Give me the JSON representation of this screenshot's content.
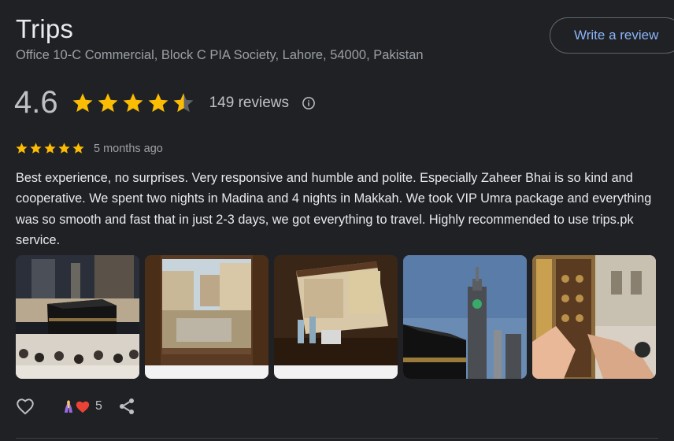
{
  "business": {
    "name": "Trips",
    "address": "Office 10-C Commercial, Block C PIA Society, Lahore, 54000, Pakistan"
  },
  "write_review_label": "Write a review",
  "rating": {
    "value": "4.6",
    "stars_value": 4.6,
    "reviews_label": "149 reviews",
    "info_icon": "info-icon"
  },
  "review": {
    "stars": 5,
    "date": "5 months ago",
    "text": "Best experience, no surprises. Very responsive and humble and polite. Especially Zaheer Bhai is so kind and cooperative. We spent two nights in Madina and 4 nights in Makkah. We took VIP Umra package and everything was so smooth and fast that in just 2-3 days, we got everything to travel. Highly recommended to use trips.pk service.",
    "photos": [
      {
        "subject": "kaaba-crowd-night"
      },
      {
        "subject": "window-view-haram"
      },
      {
        "subject": "window-view-table"
      },
      {
        "subject": "clock-tower-kaaba"
      },
      {
        "subject": "kaaba-door-hands"
      }
    ],
    "reactions": {
      "icons": [
        "pray-icon",
        "heart-icon"
      ],
      "count": "5"
    }
  },
  "colors": {
    "background": "#202124",
    "star": "#fbbc04",
    "link": "#8ab4f8",
    "heart": "#ea4335"
  }
}
